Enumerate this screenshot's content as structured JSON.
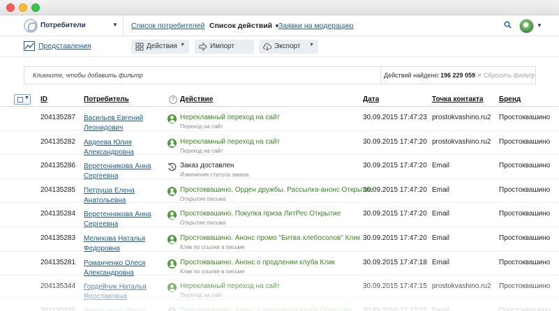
{
  "app": {
    "name": "Потребители"
  },
  "nav": {
    "consumers_list": "Список потребителей",
    "actions_list": "Список действий",
    "moderation": "Заявки на модерацию"
  },
  "toolbar": {
    "views": "Представления",
    "actions": "Действия",
    "import": "Импорт",
    "export": "Экспорт"
  },
  "filter": {
    "hint": "Кликните, чтобы добавить фильтр",
    "found_label": "Действий найдено:",
    "found_count": "196 229 059",
    "reset": "✕ Сбросить фильтр"
  },
  "table": {
    "headers": {
      "id": "ID",
      "consumer": "Потребитель",
      "action": "Действие",
      "date": "Дата",
      "contact": "Точка контакта",
      "brand": "Бренд"
    },
    "rows": [
      {
        "id": "204135287",
        "name": "Васильев Евгений Леонидович",
        "action": "Нерекламный переход на сайт",
        "sub": "Переход на сайт",
        "date": "30.09.2015 17:47:23",
        "contact": "prostokvashino.ru2",
        "brand": "Простоквашино",
        "icon": "person-icon"
      },
      {
        "id": "204135282",
        "name": "Авдеева Юлия Александровна",
        "action": "Нерекламный переход на сайт",
        "sub": "Переход на сайт",
        "date": "30.09.2015 17:47:20",
        "contact": "prostokvashino.ru2",
        "brand": "Простоквашино",
        "icon": "person-icon"
      },
      {
        "id": "204135286",
        "name": "Веретенникова Анна Сергеевна",
        "action": "Заказ доставлен",
        "sub": "Изменение статуса заказа",
        "date": "30.09.2015 17:47:20",
        "contact": "Email",
        "brand": "Простоквашино",
        "icon": "delivery-icon"
      },
      {
        "id": "204135285",
        "name": "Петруша Елена Анатольевна",
        "action": "Простоквашино. Орден дружбы. Рассылка-анонс Открытие",
        "sub": "Открытие письма",
        "date": "30.09.2015 17:47:20",
        "contact": "Email",
        "brand": "Простоквашино",
        "icon": "person-icon"
      },
      {
        "id": "204135284",
        "name": "Веретенникова Анна Сергеевна",
        "action": "Простоквашино. Покупка приза ЛитРес Открытие",
        "sub": "Открытие письма",
        "date": "30.09.2015 17:47:20",
        "contact": "Email",
        "brand": "Простоквашино",
        "icon": "person-icon"
      },
      {
        "id": "204135283",
        "name": "Мелихова Наталья Федоровна",
        "action": "Простоквашино. Анонс промо \"Битва хлебосолов\" Клик",
        "sub": "Клик по ссылке в письме",
        "date": "30.09.2015 17:47:20",
        "contact": "Email",
        "brand": "Простоквашино",
        "icon": "person-icon"
      },
      {
        "id": "204135281",
        "name": "Романченко Олеся Александровна",
        "action": "Простоквашино. Анонс о продлении клуба Клик",
        "sub": "Клик по ссылке в письме",
        "date": "30.09.2015 17:47:18",
        "contact": "Email",
        "brand": "Простоквашино",
        "icon": "person-icon"
      },
      {
        "id": "204135344",
        "name": "Гордейчик Наталья Ярославовна",
        "action": "Нерекламный переход на сайт",
        "sub": "Переход на сайт",
        "date": "30.09.2015 17:47:15",
        "contact": "prostokvashino.ru2",
        "brand": "Простоквашино",
        "icon": "person-icon"
      },
      {
        "id": "204135280",
        "name": "Романченко Олеся Александровна",
        "action": "Простоквашино. Анонс о продлении клуба Открытие",
        "sub": "Открытие письма",
        "date": "30.09.2015 17:47:15",
        "contact": "Email",
        "brand": "Простоквашино",
        "icon": "person-icon"
      }
    ]
  },
  "colors": {
    "link": "#1d5c95",
    "action_green": "#3a8a1f",
    "accent_icon": "#4a9d34"
  }
}
